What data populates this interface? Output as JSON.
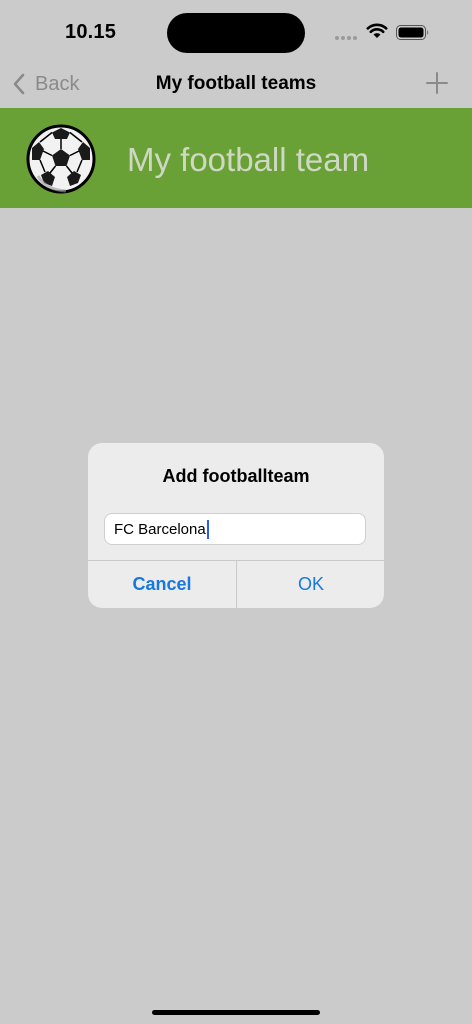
{
  "status_bar": {
    "time": "10.15"
  },
  "nav": {
    "back_label": "Back",
    "title": "My football teams",
    "add_icon": "plus-icon"
  },
  "header": {
    "icon": "football-icon",
    "title": "My football team",
    "background_color": "#6aa136"
  },
  "dialog": {
    "title": "Add footballteam",
    "input_value": "FC Barcelona",
    "cancel_label": "Cancel",
    "ok_label": "OK",
    "accent_color": "#1778de"
  }
}
